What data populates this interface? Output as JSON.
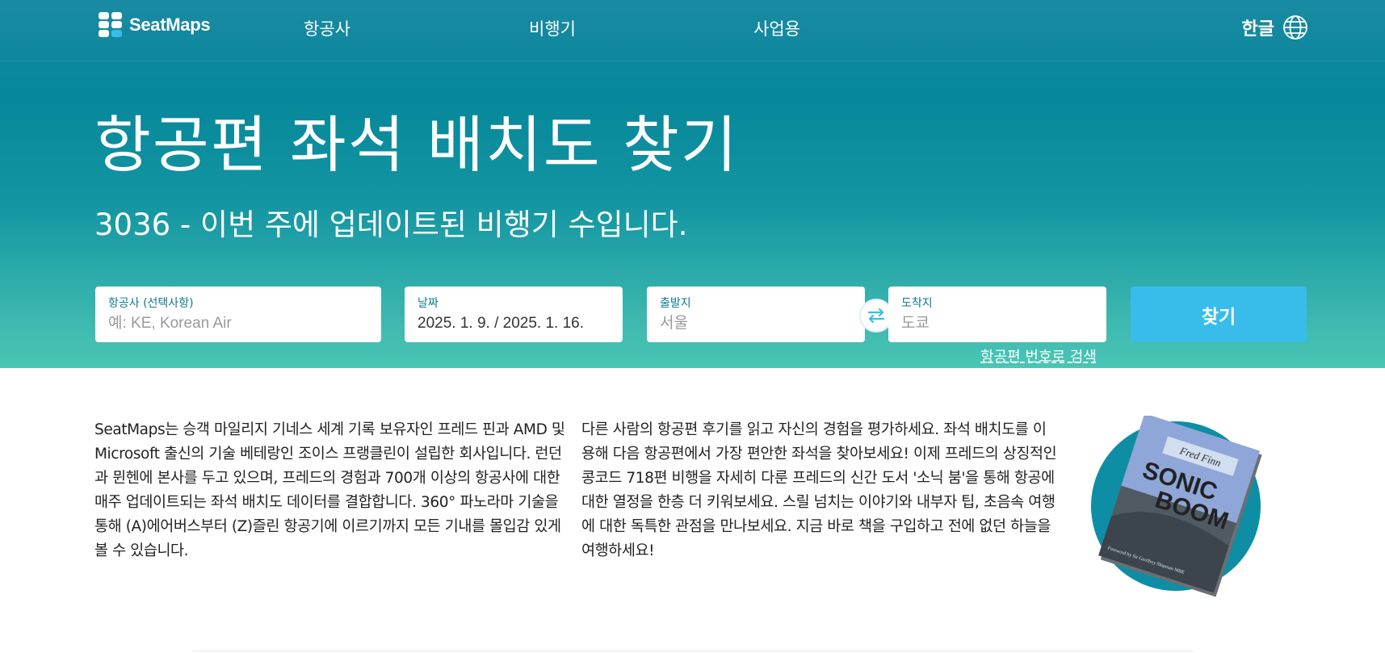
{
  "nav": {
    "logo_text": "SeatMaps",
    "items": [
      {
        "label": "항공사"
      },
      {
        "label": "비행기"
      },
      {
        "label": "사업용"
      }
    ],
    "language": "한글",
    "language_icon": "globe-icon"
  },
  "hero": {
    "title": "항공편 좌석 배치도 찾기",
    "subtitle": "3036 - 이번 주에 업데이트된 비행기 수입니다."
  },
  "search": {
    "airline": {
      "label": "항공사 (선택사항)",
      "placeholder": "예: KE, Korean Air",
      "value": ""
    },
    "date": {
      "label": "날짜",
      "value": "2025. 1. 9. / 2025. 1. 16."
    },
    "origin": {
      "label": "출발지",
      "placeholder": "서울",
      "value": ""
    },
    "destination": {
      "label": "도착지",
      "placeholder": "도쿄",
      "value": ""
    },
    "swap_icon": "swap-arrows-icon",
    "submit_label": "찾기",
    "flight_number_link": "항공편 번호로 검색"
  },
  "about": {
    "paragraph1": "SeatMaps는 승객 마일리지 기네스 세계 기록 보유자인 프레드 핀과 AMD 및 Microsoft 출신의 기술 베테랑인 조이스 프랭클린이 설립한 회사입니다. 런던과 뮌헨에 본사를 두고 있으며, 프레드의 경험과 700개 이상의 항공사에 대한 매주 업데이트되는 좌석 배치도 데이터를 결합합니다. 360° 파노라마 기술을 통해 (A)에어버스부터 (Z)즐린 항공기에 이르기까지 모든 기내를 몰입감 있게 볼 수 있습니다.",
    "paragraph2": "다른 사람의 항공편 후기를 읽고 자신의 경험을 평가하세요. 좌석 배치도를 이용해 다음 항공편에서 가장 편안한 좌석을 찾아보세요! 이제 프레드의 상징적인 콩코드 718편 비행을 자세히 다룬 프레드의 신간 도서 '소닉 붐'을 통해 항공에 대한 열정을 한층 더 키워보세요. 스릴 넘치는 이야기와 내부자 팁, 초음속 여행에 대한 독특한 관점을 만나보세요. 지금 바로 책을 구입하고 전에 없던 하늘을 여행하세요!"
  },
  "book": {
    "author": "Fred Finn",
    "title_line1": "SONIC",
    "title_line2": "BOOM",
    "foreword": "Foreword by Sir Geoffrey Shipman MBE"
  },
  "colors": {
    "hero_top": "#06879a",
    "hero_bottom": "#4ac6b5",
    "button": "#38bdea",
    "label": "#0a7a92"
  }
}
